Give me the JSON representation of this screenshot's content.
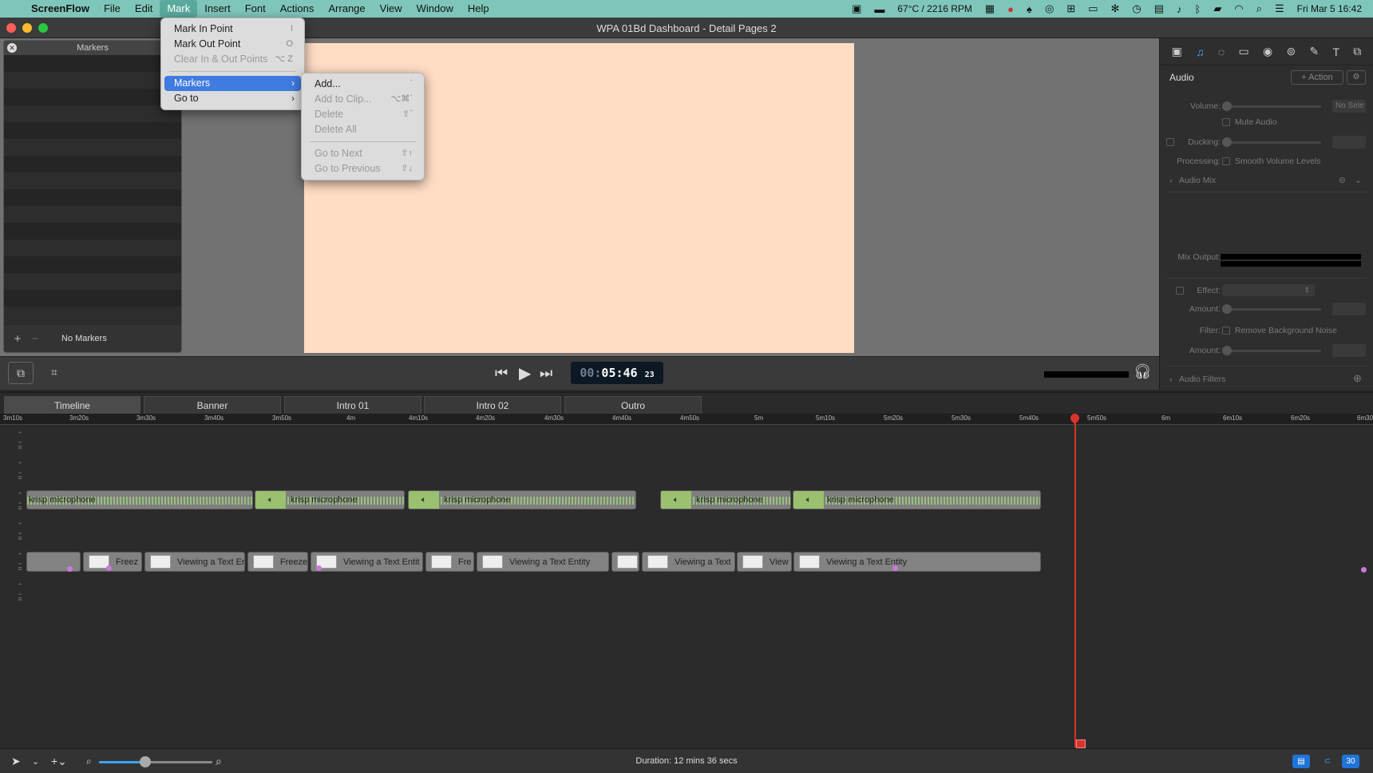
{
  "menubar": {
    "app": "ScreenFlow",
    "items": [
      "File",
      "Edit",
      "Mark",
      "Insert",
      "Font",
      "Actions",
      "Arrange",
      "View",
      "Window",
      "Help"
    ],
    "active": "Mark",
    "temp": "67°C / 2216 RPM",
    "datetime": "Fri Mar 5  16:42"
  },
  "window": {
    "title": "WPA 01Bd Dashboard - Detail Pages 2"
  },
  "markMenu": {
    "items": [
      {
        "label": "Mark In Point",
        "shortcut": "I",
        "disabled": false
      },
      {
        "label": "Mark Out Point",
        "shortcut": "O",
        "disabled": false
      },
      {
        "label": "Clear In & Out Points",
        "shortcut": "⌥ Z",
        "disabled": true
      },
      {
        "label": "Markers",
        "submenu": true,
        "highlighted": true
      },
      {
        "label": "Go to",
        "submenu": true
      }
    ]
  },
  "markersMenu": {
    "items": [
      {
        "label": "Add...",
        "shortcut": "`",
        "disabled": false
      },
      {
        "label": "Add to Clip...",
        "shortcut": "⌥⌘`",
        "disabled": true
      },
      {
        "label": "Delete",
        "shortcut": "⇧`",
        "disabled": true
      },
      {
        "label": "Delete All",
        "shortcut": "",
        "disabled": true
      },
      {
        "label": "Go to Next",
        "shortcut": "⇧↑",
        "disabled": true
      },
      {
        "label": "Go to Previous",
        "shortcut": "⇧↓",
        "disabled": true
      }
    ]
  },
  "markersPanel": {
    "title": "Markers",
    "empty": "No Markers",
    "add": "+",
    "remove": "−"
  },
  "transport": {
    "timecode_dim": "00:",
    "timecode_main": "05:46",
    "timecode_frames": "23"
  },
  "inspector": {
    "section": "Audio",
    "action_button": "+ Action",
    "volume_label": "Volume:",
    "volume_value": "No Sele",
    "mute_label": "Mute Audio",
    "ducking_label": "Ducking:",
    "processing_label": "Processing:",
    "smooth_label": "Smooth Volume Levels",
    "audio_mix": "Audio Mix",
    "mix_output": "Mix Output:",
    "effect_label": "Effect:",
    "amount_label": "Amount:",
    "filter_label": "Filter:",
    "remove_noise": "Remove Background Noise",
    "amount2_label": "Amount:",
    "audio_filters": "Audio Filters"
  },
  "tabs": [
    "Timeline",
    "Banner",
    "Intro 01",
    "Intro 02",
    "Outro"
  ],
  "ruler": [
    "3m10s",
    "3m20s",
    "3m30s",
    "3m40s",
    "3m50s",
    "4m",
    "4m10s",
    "4m20s",
    "4m30s",
    "4m40s",
    "4m50s",
    "5m",
    "5m10s",
    "5m20s",
    "5m30s",
    "5m40s",
    "5m50s",
    "6m",
    "6m10s",
    "6m20s",
    "6m30"
  ],
  "audioClips": [
    "krisp microphone",
    "krisp microphone",
    "krisp microphone",
    "krisp microphone",
    "krisp microphone"
  ],
  "videoClips": [
    "",
    "Freez",
    "Viewing a Text Er",
    "Freeze",
    "Viewing a Text Entit",
    "Fre",
    "Viewing a Text Entity",
    "",
    "Viewing a Text",
    "View",
    "Viewing a Text Entity"
  ],
  "bottombar": {
    "duration": "Duration: 12 mins 36 secs",
    "badge": "30"
  }
}
